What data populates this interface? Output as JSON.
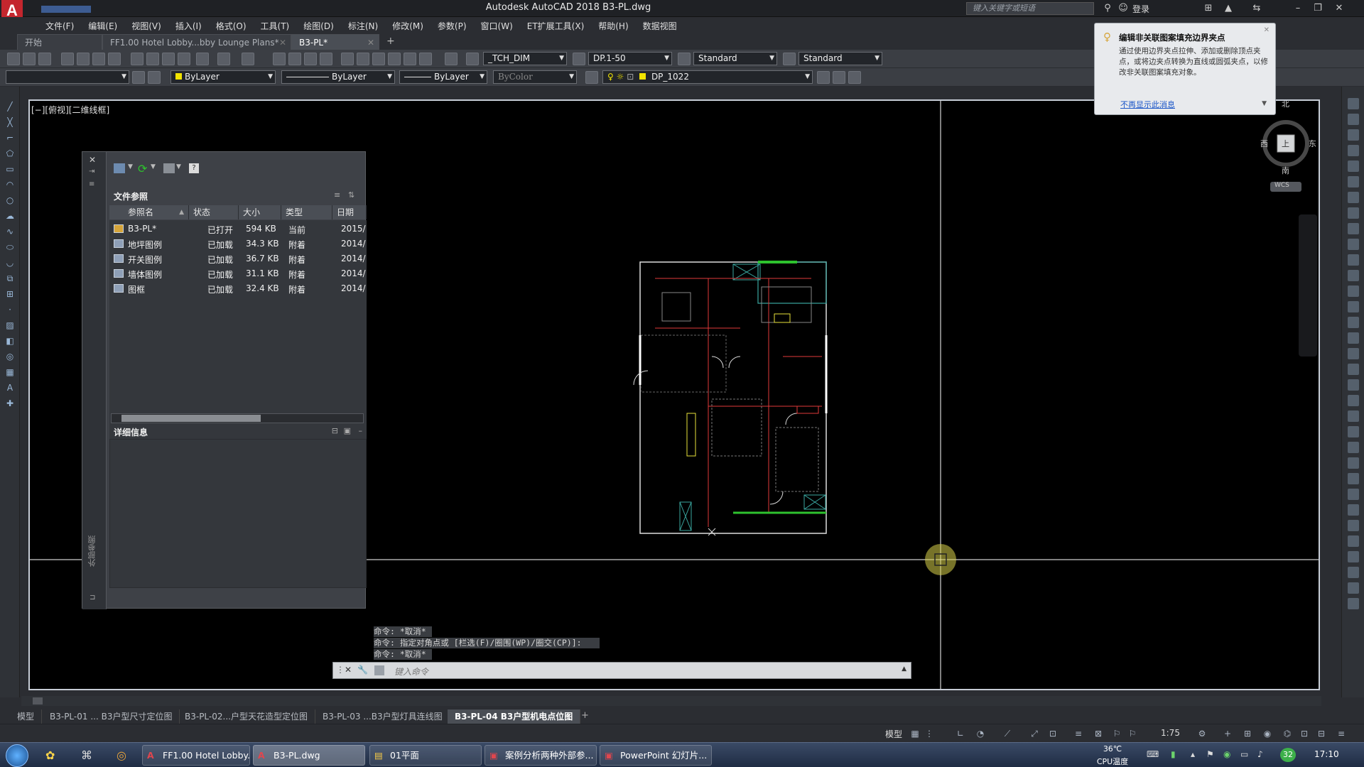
{
  "window": {
    "title": "Autodesk AutoCAD 2018    B3-PL.dwg",
    "search_placeholder": "键入关键字或短语",
    "login_label": "登录",
    "logo_letter": "A"
  },
  "menu": [
    "文件(F)",
    "编辑(E)",
    "视图(V)",
    "插入(I)",
    "格式(O)",
    "工具(T)",
    "绘图(D)",
    "标注(N)",
    "修改(M)",
    "参数(P)",
    "窗口(W)",
    "ET扩展工具(X)",
    "帮助(H)",
    "数据视图"
  ],
  "doc_tabs": {
    "start": "开始",
    "file1": "FF1.00 Hotel Lobby...bby Lounge Plans*",
    "file2": "B3-PL*"
  },
  "toolbar": {
    "dim_style": "_TCH_DIM",
    "scale": "DP.1-50",
    "text_style": "Standard",
    "table_style": "Standard",
    "layer": "ByLayer",
    "linetype": "ByLayer",
    "lineweight": "ByLayer",
    "plot_style": "ByColor",
    "current_layer": "DP_1022"
  },
  "view_label": "[−][俯视][二维线框]",
  "viewcube": {
    "north": "北",
    "south": "南",
    "east": "东",
    "west": "西",
    "top_face": "上",
    "wcs": "WCS"
  },
  "xref": {
    "section_title": "文件参照",
    "columns": [
      "参照名",
      "状态",
      "大小",
      "类型",
      "日期"
    ],
    "rows": [
      {
        "name": "B3-PL*",
        "status": "已打开",
        "size": "594 KB",
        "type": "当前",
        "date": "2015/"
      },
      {
        "name": "地坪图例",
        "status": "已加载",
        "size": "34.3 KB",
        "type": "附着",
        "date": "2014/"
      },
      {
        "name": "开关图例",
        "status": "已加载",
        "size": "36.7 KB",
        "type": "附着",
        "date": "2014/"
      },
      {
        "name": "墙体图例",
        "status": "已加载",
        "size": "31.1 KB",
        "type": "附着",
        "date": "2014/"
      },
      {
        "name": "图框",
        "status": "已加载",
        "size": "32.4 KB",
        "type": "附着",
        "date": "2014/"
      }
    ],
    "details_title": "详细信息",
    "palette_label": "外部参照"
  },
  "command": {
    "history": [
      "命令: *取消*",
      "命令: 指定对角点或 [栏选(F)/圈围(WP)/圈交(CP)]:",
      "命令: *取消*"
    ],
    "placeholder": "键入命令"
  },
  "layout_tabs": [
    "模型",
    "B3-PL-01 ... B3户型尺寸定位图",
    "B3-PL-02...户型天花造型定位图",
    "B3-PL-03 ...B3户型灯具连线图",
    "B3-PL-04 B3户型机电点位图"
  ],
  "status": {
    "model": "模型",
    "scale": "1:75"
  },
  "tooltip": {
    "title": "编辑非关联图案填充边界夹点",
    "body": "通过使用边界夹点拉伸、添加或删除顶点夹点，或将边夹点转换为直线或圆弧夹点，以修改非关联图案填充对象。",
    "link": "不再显示此消息"
  },
  "taskbar": {
    "items": [
      "FF1.00 Hotel Lobby...",
      "B3-PL.dwg",
      "01平面",
      "案例分析两种外部参...",
      "PowerPoint 幻灯片..."
    ],
    "temp": "36℃",
    "temp_label": "CPU温度",
    "badge": "32",
    "clock": "17:10"
  },
  "colors": {
    "accent": "#c4262e",
    "canvas": "#000000",
    "crosshair": "#ffffff",
    "cursor": "#e8e23a"
  }
}
